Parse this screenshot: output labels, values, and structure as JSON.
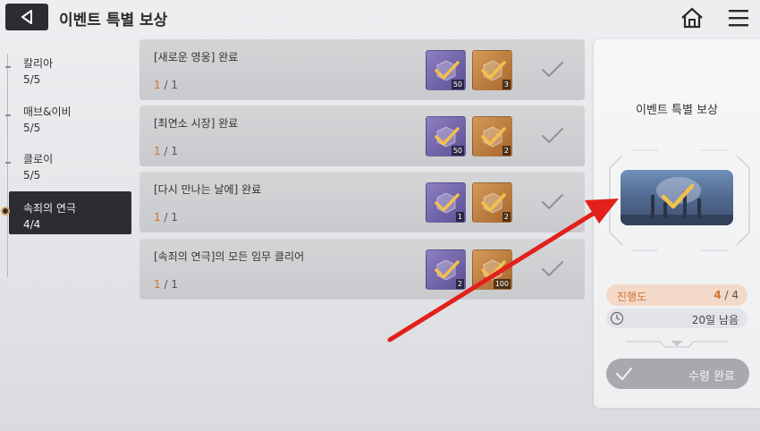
{
  "header": {
    "title": "이벤트 특별 보상",
    "back_icon": "back-arrow-icon",
    "home_icon": "home-icon",
    "menu_icon": "menu-icon"
  },
  "sidebar": {
    "items": [
      {
        "label": "칼리아",
        "progress": "5/5"
      },
      {
        "label": "매브&이비",
        "progress": "5/5"
      },
      {
        "label": "클로이",
        "progress": "5/5"
      },
      {
        "label": "속죄의 연극",
        "progress": "4/4",
        "active": true
      }
    ]
  },
  "quests": [
    {
      "title": "[새로운 영웅] 완료",
      "current": "1",
      "total": "/ 1",
      "rewards": [
        {
          "color": "purple",
          "count": "50"
        },
        {
          "color": "orange",
          "count": "3"
        }
      ]
    },
    {
      "title": "[최연소 시장] 완료",
      "current": "1",
      "total": "/ 1",
      "rewards": [
        {
          "color": "purple",
          "count": "50"
        },
        {
          "color": "orange",
          "count": "2"
        }
      ]
    },
    {
      "title": "[다시 만나는 날에] 완료",
      "current": "1",
      "total": "/ 1",
      "rewards": [
        {
          "color": "purple",
          "count": "1"
        },
        {
          "color": "orange",
          "count": "2"
        }
      ]
    },
    {
      "title": "[속죄의 연극]의 모든 임무 클리어",
      "current": "1",
      "total": "/ 1",
      "rewards": [
        {
          "color": "purple",
          "count": "2"
        },
        {
          "color": "orange",
          "count": "100"
        }
      ]
    }
  ],
  "panel": {
    "title": "이벤트 특별 보상",
    "progress_label": "진행도",
    "progress_current": "4",
    "progress_total": " / 4",
    "time_left": "20일 남음",
    "claim_label": "수령 완료"
  },
  "colors": {
    "accent_orange": "#d0742e",
    "check_gold": "#f2c14e",
    "dark": "#2b2d31",
    "arrow_red": "#e3201b"
  }
}
